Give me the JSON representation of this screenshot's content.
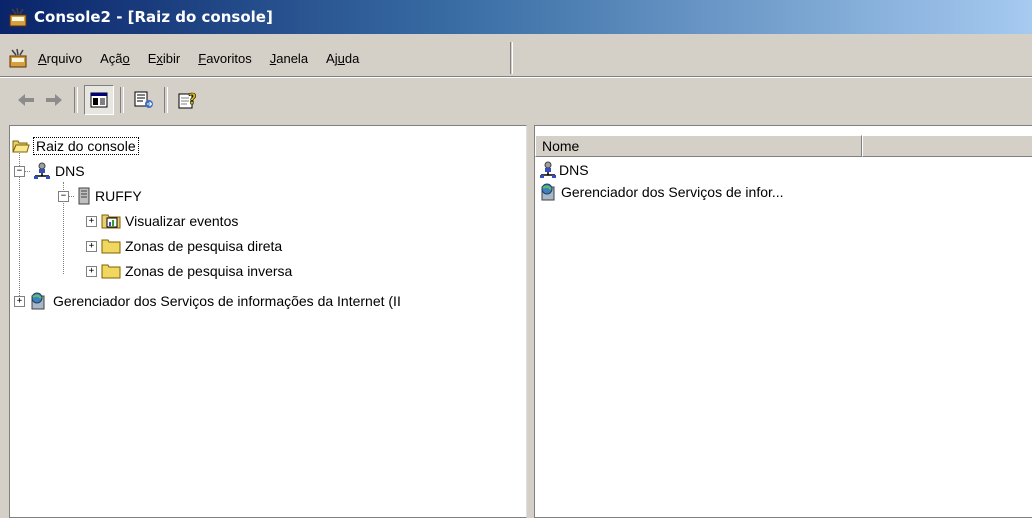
{
  "window": {
    "title": "Console2 - [Raiz do console]"
  },
  "menu": {
    "items": [
      {
        "pre": "",
        "u": "A",
        "post": "rquivo"
      },
      {
        "pre": "Açã",
        "u": "o",
        "post": ""
      },
      {
        "pre": "E",
        "u": "x",
        "post": "ibir"
      },
      {
        "pre": "",
        "u": "F",
        "post": "avoritos"
      },
      {
        "pre": "",
        "u": "J",
        "post": "anela"
      },
      {
        "pre": "Aj",
        "u": "u",
        "post": "da"
      }
    ]
  },
  "toolbar": {
    "buttons": [
      "back-arrow-icon",
      "forward-arrow-icon",
      "show-hide-tree-icon",
      "export-list-icon",
      "help-icon"
    ]
  },
  "tree": {
    "root": "Raiz do console",
    "dns": "DNS",
    "server": "RUFFY",
    "events": "Visualizar eventos",
    "forward_zones": "Zonas de pesquisa direta",
    "reverse_zones": "Zonas de pesquisa inversa",
    "iis": "Gerenciador dos Serviços de informações da Internet (II"
  },
  "list": {
    "columns": [
      "Nome",
      ""
    ],
    "items": [
      "DNS",
      "Gerenciador dos Serviços de infor..."
    ]
  },
  "colors": {
    "title_start": "#0a246a",
    "title_end": "#a6caf0",
    "chrome": "#d4d0c8"
  }
}
